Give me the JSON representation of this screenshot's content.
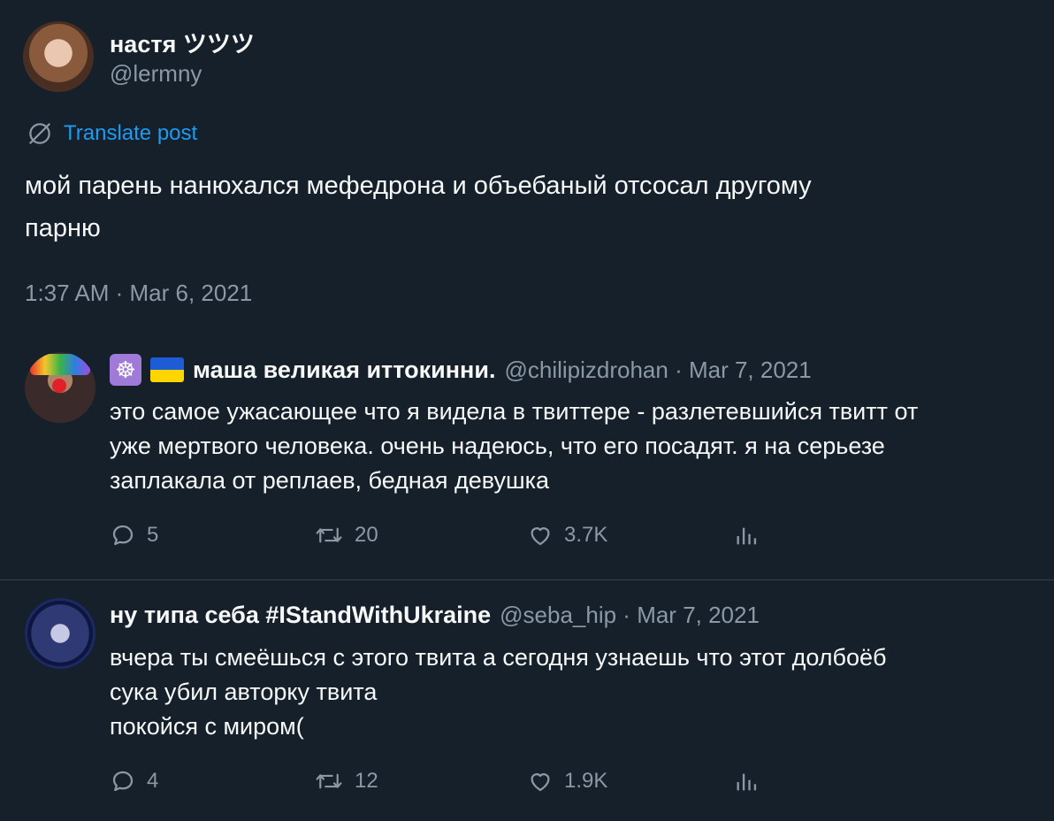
{
  "main_tweet": {
    "author_name": "настя ツツツ",
    "handle": "@lermny",
    "translate_label": "Translate post",
    "text_line1": "мой парень нанюхался мефедрона и объебаный отсосал другому",
    "text_line2": "парню",
    "timestamp": "1:37 AM · Mar 6, 2021"
  },
  "replies": [
    {
      "author_name": "маша великая иттокинни.",
      "name_emojis": [
        "wheel-of-dharma-emoji",
        "ukraine-flag-emoji"
      ],
      "meta": "@chilipizdrohan · Mar 7, 2021",
      "text": "это самое ужасающее что я видела в твиттере - разлетевшийся твитт от\nуже мертвого человека. очень надеюсь, что его посадят. я на серьезе\nзаплакала от реплаев, бедная девушка",
      "replies_count": "5",
      "retweets_count": "20",
      "likes_count": "3.7K"
    },
    {
      "author_name": "ну типа себа #IStandWithUkraine",
      "meta": "@seba_hip · Mar 7, 2021",
      "text": "вчера ты смеёшься с этого твита а сегодня узнаешь что этот долбоёб\nсука убил авторку твита\nпокойся с миром(",
      "replies_count": "4",
      "retweets_count": "12",
      "likes_count": "1.9K"
    }
  ],
  "colors": {
    "background": "#15202b",
    "text_primary": "#f7f9f9",
    "text_secondary": "#8b98a5",
    "link": "#1d9bf0",
    "divider": "#38444d"
  },
  "icons": {
    "translate": "globe-slash-icon",
    "reply": "speech-bubble-icon",
    "retweet": "retweet-arrows-icon",
    "like": "heart-icon",
    "views": "bar-chart-icon"
  }
}
